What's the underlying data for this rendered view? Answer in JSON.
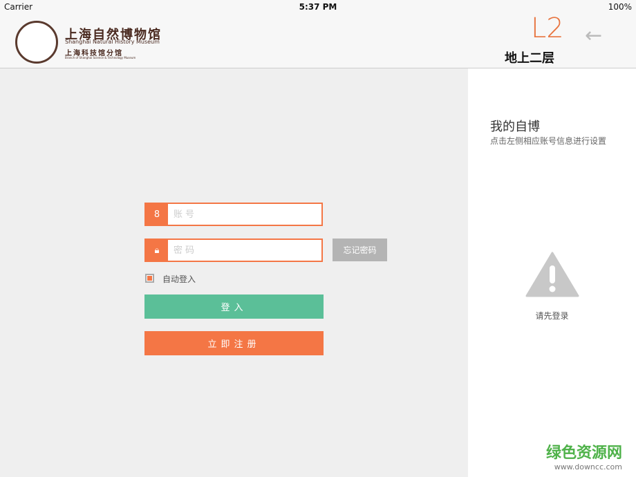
{
  "status": {
    "carrier": "Carrier",
    "time": "5:37 PM",
    "battery": "100%"
  },
  "header": {
    "logo_cn": "上海自然博物馆",
    "logo_en": "Shanghai Natural History Museum",
    "logo_sub": "上海科技馆分馆",
    "logo_sub_en": "Branch of Shanghai Science & Technology Museum",
    "floor_code": "L2",
    "floor_name": "地上二层",
    "back_icon": "arrow-left-icon"
  },
  "login": {
    "account_placeholder": "账号",
    "password_placeholder": "密码",
    "forgot": "忘记密码",
    "auto_login": "自动登入",
    "auto_login_checked": true,
    "login_button": "登入",
    "register_button": "立即注册"
  },
  "panel": {
    "title": "我的自博",
    "subtitle": "点击左侧相应账号信息进行设置",
    "notice": "请先登录"
  },
  "watermark": {
    "cn": "绿色资源网",
    "url": "www.downcc.com"
  },
  "colors": {
    "accent": "#f47645",
    "green": "#5bbf98",
    "gray": "#b4b4b4"
  }
}
